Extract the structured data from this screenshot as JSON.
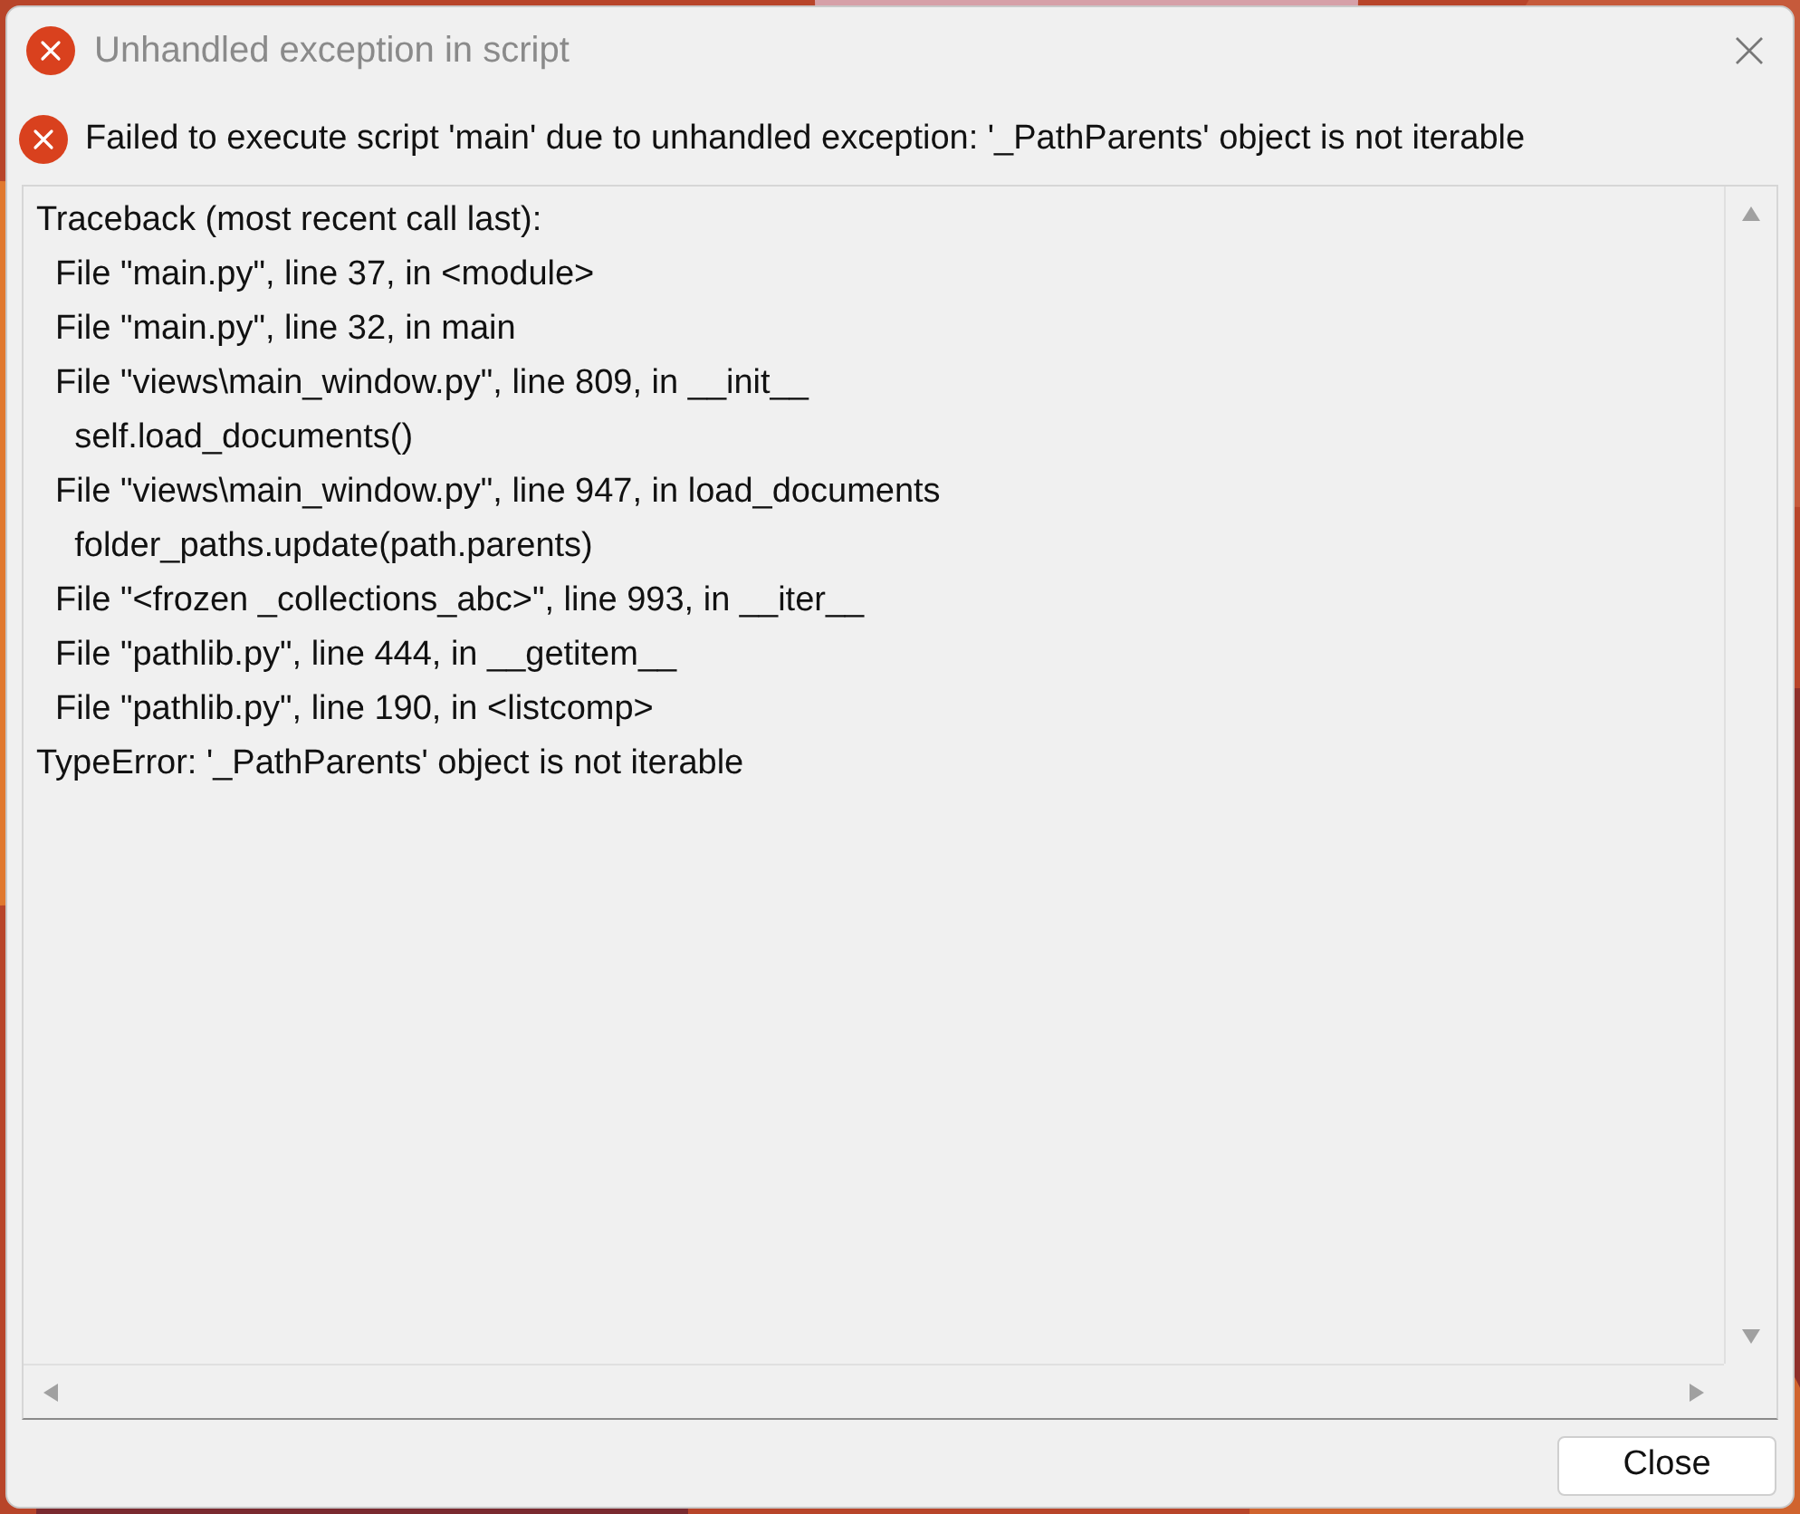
{
  "window": {
    "title": "Unhandled exception in script"
  },
  "message": "Failed to execute script 'main' due to unhandled exception: '_PathParents' object is not iterable",
  "traceback": [
    "Traceback (most recent call last):",
    "  File \"main.py\", line 37, in <module>",
    "  File \"main.py\", line 32, in main",
    "  File \"views\\main_window.py\", line 809, in __init__",
    "    self.load_documents()",
    "  File \"views\\main_window.py\", line 947, in load_documents",
    "    folder_paths.update(path.parents)",
    "  File \"<frozen _collections_abc>\", line 993, in __iter__",
    "  File \"pathlib.py\", line 444, in __getitem__",
    "  File \"pathlib.py\", line 190, in <listcomp>",
    "TypeError: '_PathParents' object is not iterable"
  ],
  "buttons": [
    "Close"
  ]
}
